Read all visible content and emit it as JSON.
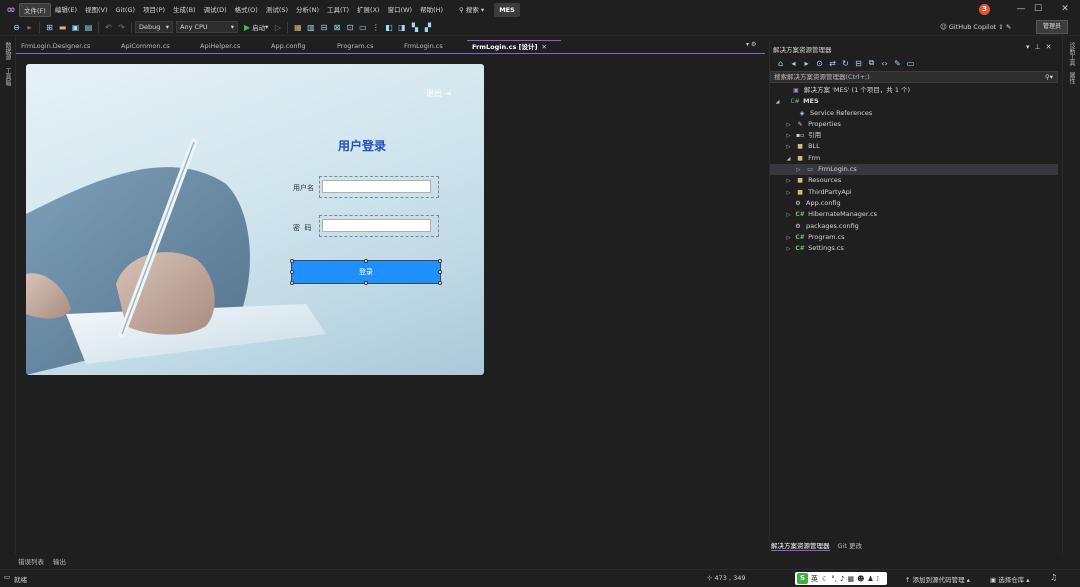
{
  "menubar": {
    "logo": "VS",
    "items": [
      "文件(F)",
      "编辑(E)",
      "视图(V)",
      "Git(G)",
      "项目(P)",
      "生成(B)",
      "调试(D)",
      "格式(O)",
      "测试(S)",
      "分析(N)",
      "工具(T)",
      "扩展(X)",
      "窗口(W)",
      "帮助(H)"
    ],
    "search": "搜索",
    "solution": "MES",
    "notifications": "3",
    "window_controls": [
      "—",
      "☐",
      "✕"
    ]
  },
  "toolbar": {
    "config": "Debug",
    "platform": "Any CPU",
    "start": "启动",
    "copilot": "GitHub Copilot",
    "admin": "管理员"
  },
  "left_rail": [
    "数据源",
    "工具箱"
  ],
  "right_rail": [
    "诊断工具",
    "属性"
  ],
  "tabs": [
    {
      "label": "FrmLogin.Designer.cs",
      "active": false
    },
    {
      "label": "ApiCommon.cs",
      "active": false
    },
    {
      "label": "ApiHelper.cs",
      "active": false
    },
    {
      "label": "App.config",
      "active": false
    },
    {
      "label": "Program.cs",
      "active": false
    },
    {
      "label": "FrmLogin.cs",
      "active": false
    },
    {
      "label": "FrmLogin.cs [设计]",
      "active": true
    }
  ],
  "designer": {
    "logout": "退出",
    "title": "用户登录",
    "username_label": "用户名",
    "password_label": "密  码",
    "login_button": "登录"
  },
  "solution_explorer": {
    "title": "解决方案资源管理器",
    "search_placeholder": "搜索解决方案资源管理器(Ctrl+;)",
    "tree": [
      {
        "label": "解决方案 'MES' (1 个项目，共 1 个)",
        "icon": "solution-icon",
        "indent": 0,
        "arrow": ""
      },
      {
        "label": "MES",
        "icon": "csharp-project-icon",
        "indent": 0,
        "arrow": "◢",
        "bold": true
      },
      {
        "label": "Service References",
        "icon": "service-reference-icon",
        "indent": 1,
        "arrow": ""
      },
      {
        "label": "Properties",
        "icon": "wrench-icon",
        "indent": 1,
        "arrow": "▷"
      },
      {
        "label": "引用",
        "icon": "references-icon",
        "indent": 1,
        "arrow": "▷"
      },
      {
        "label": "BLL",
        "icon": "folder-icon",
        "indent": 1,
        "arrow": "▷"
      },
      {
        "label": "Frm",
        "icon": "folder-icon",
        "indent": 1,
        "arrow": "◢"
      },
      {
        "label": "FrmLogin.cs",
        "icon": "form-icon",
        "indent": 2,
        "arrow": "▷",
        "selected": true
      },
      {
        "label": "Resources",
        "icon": "folder-icon",
        "indent": 1,
        "arrow": "▷"
      },
      {
        "label": "ThirdPartyApi",
        "icon": "folder-icon",
        "indent": 1,
        "arrow": "▷"
      },
      {
        "label": "App.config",
        "icon": "config-icon",
        "indent": 1,
        "arrow": ""
      },
      {
        "label": "HibernateManager.cs",
        "icon": "csharp-file-icon",
        "indent": 1,
        "arrow": "▷"
      },
      {
        "label": "packages.config",
        "icon": "config-icon",
        "indent": 1,
        "arrow": ""
      },
      {
        "label": "Program.cs",
        "icon": "csharp-file-icon",
        "indent": 1,
        "arrow": "▷"
      },
      {
        "label": "Settings.cs",
        "icon": "csharp-file-icon",
        "indent": 1,
        "arrow": "▷"
      }
    ],
    "bottom_tabs": [
      "解决方案资源管理器",
      "Git 更改"
    ]
  },
  "bottom_tabs": [
    "错误列表",
    "输出"
  ],
  "statusbar": {
    "ready": "就绪",
    "position": "473 , 349",
    "ime": "英",
    "add_source": "添加到源代码管理",
    "select_repo": "选择仓库"
  }
}
